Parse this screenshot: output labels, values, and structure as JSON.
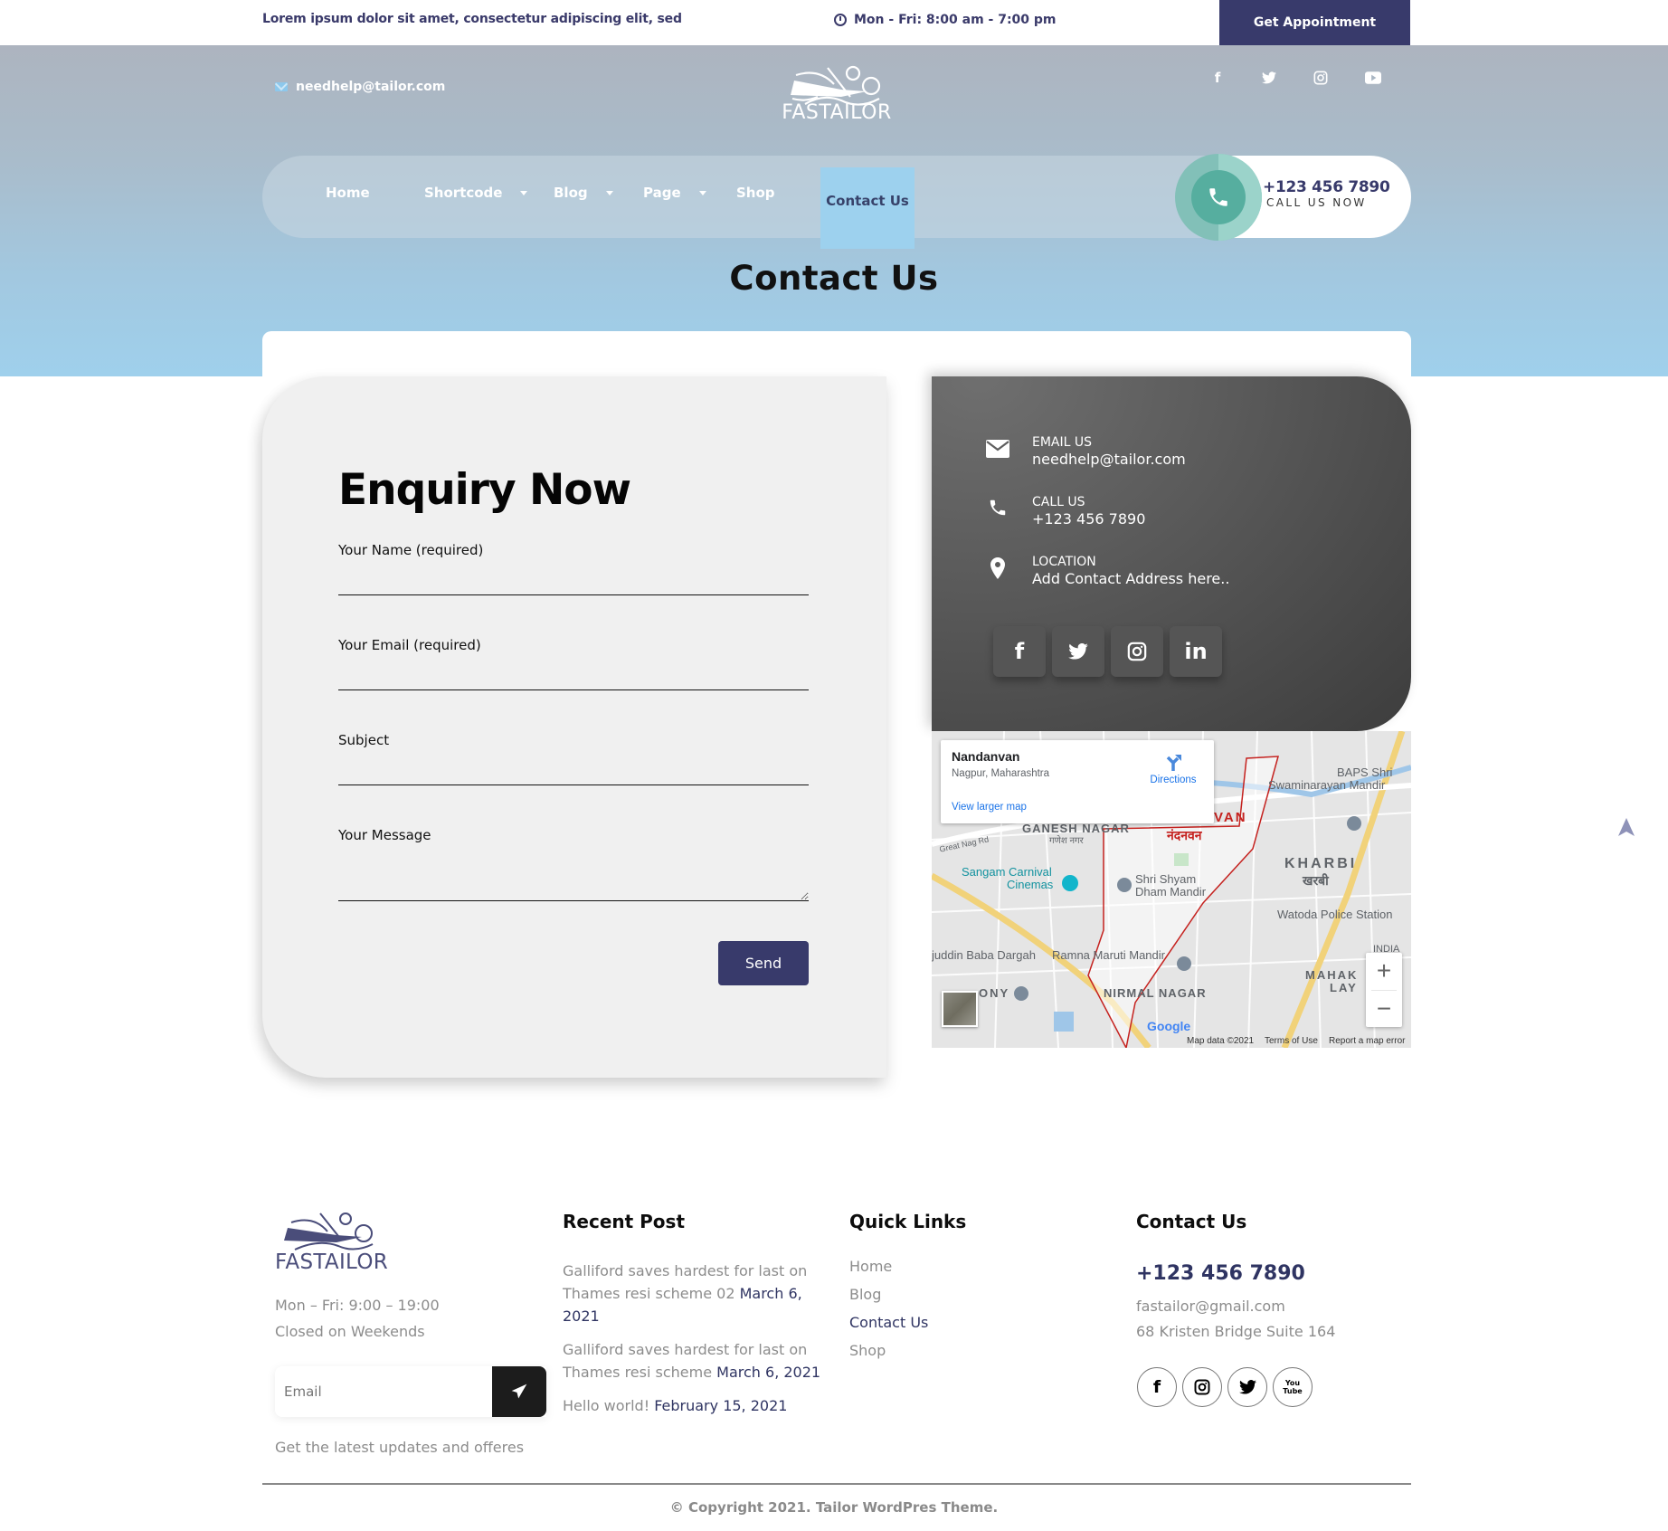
{
  "topbar": {
    "tagline": "Lorem ipsum dolor sit amet, consectetur adipiscing elit, sed",
    "hours": "Mon - Fri: 8:00 am - 7:00 pm",
    "appointment_button": "Get Appointment"
  },
  "header": {
    "email": "needhelp@tailor.com",
    "logo_text": "FASTAILOR",
    "social": [
      {
        "icon": "facebook-icon",
        "glyph": "f"
      },
      {
        "icon": "twitter-icon",
        "glyph": "🐦"
      },
      {
        "icon": "instagram-icon",
        "glyph": "◎"
      },
      {
        "icon": "youtube-icon",
        "glyph": "▶"
      }
    ]
  },
  "nav": {
    "items": [
      {
        "label": "Home",
        "has_dropdown": false
      },
      {
        "label": "Shortcode",
        "has_dropdown": true
      },
      {
        "label": "Blog",
        "has_dropdown": true
      },
      {
        "label": "Page",
        "has_dropdown": true
      },
      {
        "label": "Shop",
        "has_dropdown": false
      },
      {
        "label": "Contact Us",
        "has_dropdown": false,
        "active": true
      }
    ],
    "call": {
      "number": "+123 456 7890",
      "label": "CALL US NOW"
    }
  },
  "page": {
    "title": "Contact Us"
  },
  "form": {
    "title": "Enquiry Now",
    "fields": [
      {
        "label": "Your Name (required)",
        "value": ""
      },
      {
        "label": "Your Email (required)",
        "value": ""
      },
      {
        "label": "Subject",
        "value": ""
      },
      {
        "label": "Your Message",
        "value": ""
      }
    ],
    "submit_label": "Send"
  },
  "info": {
    "items": [
      {
        "icon": "envelope-icon",
        "heading": "EMAIL US",
        "value": "needhelp@tailor.com"
      },
      {
        "icon": "phone-icon",
        "heading": "CALL US",
        "value": "+123 456 7890"
      },
      {
        "icon": "location-pin-icon",
        "heading": "LOCATION",
        "value": "Add Contact Address here.."
      }
    ],
    "social": [
      {
        "icon": "facebook-icon",
        "glyph": "f"
      },
      {
        "icon": "twitter-icon",
        "glyph": "🐦"
      },
      {
        "icon": "instagram-icon",
        "glyph": "◎"
      },
      {
        "icon": "linkedin-icon",
        "glyph": "in"
      }
    ]
  },
  "map": {
    "place_name": "Nandanvan",
    "place_region": "Nagpur, Maharashtra",
    "directions_label": "Directions",
    "larger_map_label": "View larger map",
    "labels": [
      "GANESH NAGAR",
      "गणेश नगर",
      "Sangam Carnival",
      "Cinemas",
      "Shri Shyam",
      "Dham Mandir",
      "KHARBI",
      "खरबी",
      "Watoda Police Station",
      "BAPS Shri",
      "Swaminarayan Mandir",
      "VAN",
      "नंदनवन",
      "Great Nag Rd",
      "juddin Baba Dargah",
      "Ramna Maruti Mandir",
      "NIRMAL NAGAR",
      "ONY",
      "MAHAK",
      "LAY",
      "INDIA"
    ],
    "google_label": "Google",
    "footer": {
      "data": "Map data ©2021",
      "terms": "Terms of Use",
      "report": "Report a map error"
    },
    "zoom_in": "+",
    "zoom_out": "−"
  },
  "footer": {
    "logo_text": "FASTAILOR",
    "hours_line1": "Mon – Fri: 9:00 – 19:00",
    "hours_line2": "Closed on Weekends",
    "subscribe_placeholder": "Email",
    "subscribe_note": "Get the latest updates and offeres",
    "recent_post": {
      "heading": "Recent Post",
      "posts": [
        {
          "title_l1": "Galliford saves hardest for last on",
          "title_l2": "Thames resi scheme 02",
          "date_a": "March 6,",
          "date_b": "2021"
        },
        {
          "title_l1": "Galliford saves hardest for last on",
          "title_l2": "Thames resi scheme",
          "date": "March 6, 2021"
        },
        {
          "title": "Hello world!",
          "date": "February 15, 2021"
        }
      ]
    },
    "quick_links": {
      "heading": "Quick Links",
      "links": [
        {
          "label": "Home",
          "active": false
        },
        {
          "label": "Blog",
          "active": false
        },
        {
          "label": "Contact Us",
          "active": true
        },
        {
          "label": "Shop",
          "active": false
        }
      ]
    },
    "contact": {
      "heading": "Contact Us",
      "phone": "+123 456 7890",
      "email": "fastailor@gmail.com",
      "address": "68 Kristen Bridge Suite 164",
      "social": [
        {
          "icon": "facebook-icon",
          "glyph": "f"
        },
        {
          "icon": "instagram-icon",
          "glyph": "◎"
        },
        {
          "icon": "twitter-icon",
          "glyph": "🐦"
        },
        {
          "icon": "youtube-icon",
          "glyph": "You Tube"
        }
      ]
    },
    "copyright": "© Copyright 2021. Tailor WordPres Theme."
  },
  "colors": {
    "brand_navy": "#383a6b",
    "teal": "#56ae9f",
    "hero_blue": "#9fd0ec",
    "active_nav_bg": "#9dd1ee",
    "form_bg": "#f0f0f0",
    "info_panel_dark": "#3d3d3d"
  }
}
